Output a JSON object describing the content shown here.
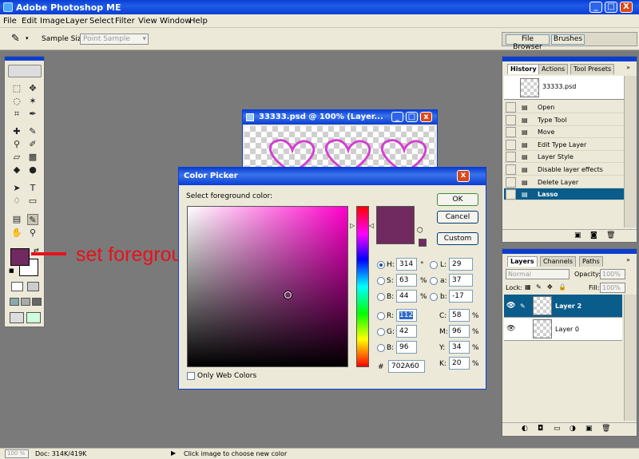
{
  "app": {
    "title": "Adobe Photoshop ME",
    "min": "_",
    "max": "□",
    "close": "X"
  },
  "menu": [
    "File",
    "Edit",
    "Image",
    "Layer",
    "Select",
    "Filter",
    "View",
    "Window",
    "Help"
  ],
  "options": {
    "sample_size_label": "Sample Size:",
    "sample_size_value": "Point Sample",
    "file_browser": "File Browser",
    "brushes": "Brushes"
  },
  "document": {
    "title": "33333.psd @ 100% (Layer..."
  },
  "annotation": {
    "text": "set foreground color",
    "color": "#e8101a"
  },
  "history_panel": {
    "tabs": [
      "History",
      "Actions",
      "Tool Presets"
    ],
    "snapshot": "33333.psd",
    "items": [
      "Open",
      "Type Tool",
      "Move",
      "Edit Type Layer",
      "Layer Style",
      "Disable layer effects",
      "Delete Layer",
      "Lasso"
    ],
    "selected_index": 7
  },
  "layers_panel": {
    "tabs": [
      "Layers",
      "Channels",
      "Paths"
    ],
    "blend_mode": "Normal",
    "opacity_label": "Opacity:",
    "opacity_value": "100%",
    "lock_label": "Lock:",
    "fill_label": "Fill:",
    "fill_value": "100%",
    "layers": [
      "Layer 2",
      "Layer 0"
    ]
  },
  "color_picker": {
    "title": "Color Picker",
    "prompt": "Select foreground color:",
    "buttons": {
      "ok": "OK",
      "cancel": "Cancel",
      "custom": "Custom"
    },
    "fields": {
      "H": {
        "label": "H:",
        "value": "314",
        "unit": "°"
      },
      "S": {
        "label": "S:",
        "value": "63",
        "unit": "%"
      },
      "B": {
        "label": "B:",
        "value": "44",
        "unit": "%"
      },
      "R": {
        "label": "R:",
        "value": "112"
      },
      "G": {
        "label": "G:",
        "value": "42"
      },
      "Bv": {
        "label": "B:",
        "value": "96"
      },
      "L": {
        "label": "L:",
        "value": "29"
      },
      "a": {
        "label": "a:",
        "value": "37"
      },
      "b": {
        "label": "b:",
        "value": "-17"
      },
      "C": {
        "label": "C:",
        "value": "58",
        "unit": "%"
      },
      "M": {
        "label": "M:",
        "value": "96",
        "unit": "%"
      },
      "Y": {
        "label": "Y:",
        "value": "34",
        "unit": "%"
      },
      "K": {
        "label": "K:",
        "value": "20",
        "unit": "%"
      }
    },
    "hex_label": "#",
    "hex": "702A60",
    "web_only": "Only Web Colors",
    "color": "#702a60",
    "hue_color": "#ff00cc"
  },
  "status": {
    "zoom": "100 %",
    "doc": "Doc: 314K/419K",
    "hint": "Click image to choose new color"
  }
}
